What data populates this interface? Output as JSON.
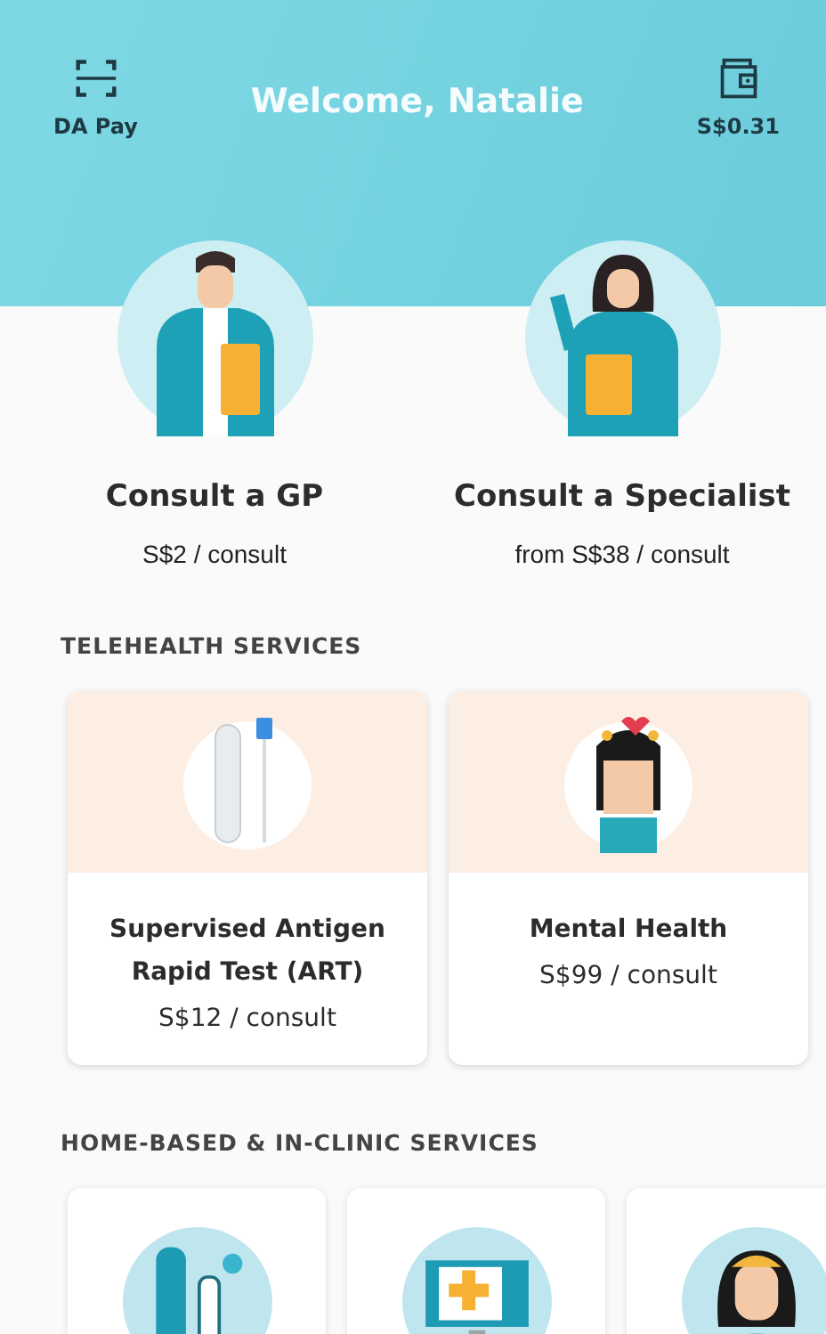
{
  "header": {
    "pay_label": "DA Pay",
    "welcome": "Welcome, Natalie",
    "wallet_balance": "S$0.31"
  },
  "consult_options": [
    {
      "title": "Consult a GP",
      "price": "S$2 / consult"
    },
    {
      "title": "Consult a Specialist",
      "price": "from S$38 / consult"
    }
  ],
  "telehealth": {
    "heading": "TELEHEALTH SERVICES",
    "services": [
      {
        "kind": "swab",
        "title": "Supervised Antigen Rapid Test (ART)",
        "price": "S$12 / consult"
      },
      {
        "kind": "mind",
        "title": "Mental Health",
        "price": "S$99 / consult"
      }
    ]
  },
  "home_clinic": {
    "heading": "HOME-BASED & IN-CLINIC SERVICES",
    "services": [
      {
        "kind": "lab"
      },
      {
        "kind": "screen"
      },
      {
        "kind": "nurse"
      }
    ]
  }
}
